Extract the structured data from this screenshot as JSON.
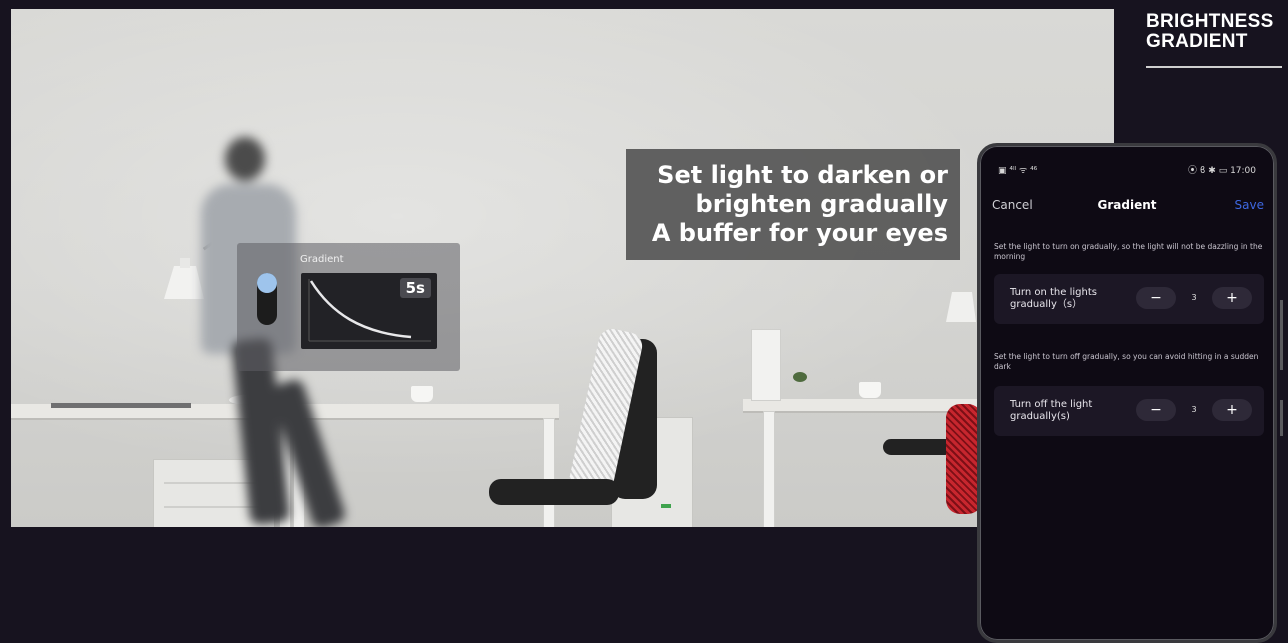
{
  "heading": {
    "line1": "BRIGHTNESS",
    "line2": "GRADIENT"
  },
  "tagline": {
    "line1": "Set light to darken or",
    "line2": "brighten gradually",
    "line3": "A buffer for your eyes"
  },
  "widget": {
    "title": "Gradient",
    "value": "5s"
  },
  "phone": {
    "status_left": "▣ ⁴ᴵˡ ᯤ ⁴⁶",
    "status_right": "⦿ ϐ ✱ ▭ 17:00",
    "header": {
      "cancel": "Cancel",
      "title": "Gradient",
      "save": "Save"
    },
    "settings": [
      {
        "description": "Set the light to turn on gradually, so the light will not be dazzling in the morning",
        "label_line1": "Turn on the lights",
        "label_line2": "gradually（s）",
        "value": "3",
        "minus": "−",
        "plus": "+"
      },
      {
        "description": "Set the light to turn off gradually, so you can avoid hitting in a sudden dark",
        "label_line1": "Turn off the light",
        "label_line2": "gradually(s)",
        "value": "3",
        "minus": "−",
        "plus": "+"
      }
    ]
  },
  "colors": {
    "page_background": "#17131f",
    "phone_background": "#0e0a14",
    "save_accent": "#3d67e0",
    "switch_knob": "#9ec4ec"
  }
}
